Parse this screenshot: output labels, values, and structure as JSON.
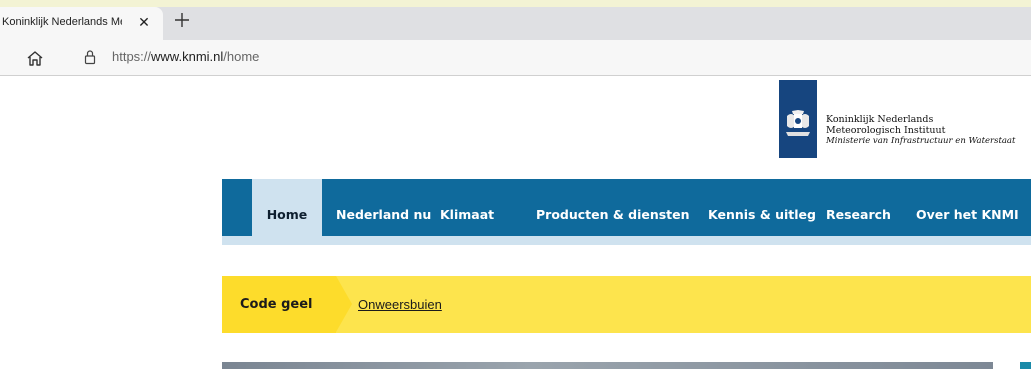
{
  "browser": {
    "tab_title": "Koninklijk Nederlands Me",
    "close_glyph": "✕",
    "url_prefix": "https://",
    "url_host": "www.knmi.nl",
    "url_path": "/home",
    "icons": [
      "home-icon",
      "lock-icon",
      "new-tab-icon",
      "close-icon"
    ]
  },
  "header": {
    "org_line1": "Koninklijk Nederlands",
    "org_line2": "Meteorologisch Instituut",
    "org_line3": "Ministerie van Infrastructuur en Waterstaat",
    "logo_color": "#16457f"
  },
  "nav": {
    "color": "#0f6a9c",
    "items": [
      {
        "label": "Home",
        "active": true
      },
      {
        "label": "Nederland nu"
      },
      {
        "label": "Klimaat"
      },
      {
        "label": "Producten & diensten"
      },
      {
        "label": "Kennis & uitleg"
      },
      {
        "label": "Research"
      },
      {
        "label": "Over het KNMI"
      }
    ]
  },
  "alert": {
    "level": "Code geel",
    "link": "Onweersbuien",
    "color": "#fde44d"
  }
}
